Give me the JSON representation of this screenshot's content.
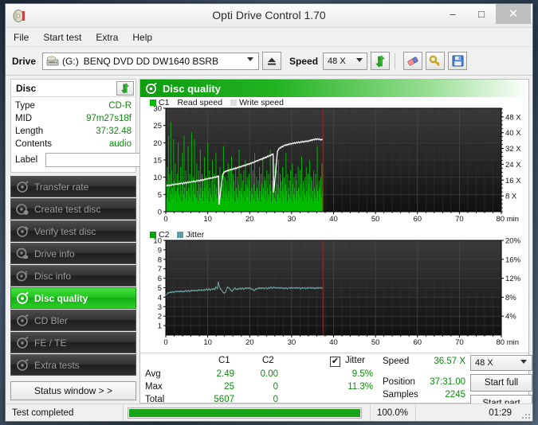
{
  "window": {
    "title": "Opti Drive Control 1.70",
    "app_icon": "disc-icon",
    "minimize": "–",
    "maximize": "□",
    "close": "✕"
  },
  "menubar": {
    "items": [
      {
        "label": "File"
      },
      {
        "label": "Start test"
      },
      {
        "label": "Extra"
      },
      {
        "label": "Help"
      }
    ]
  },
  "toolbar": {
    "drive_label": "Drive",
    "drive_letter": "(G:)",
    "drive_name": "BENQ DVD DD DW1640 BSRB",
    "drive_icon": "optical-drive-icon",
    "eject_icon": "eject-icon",
    "speed_label": "Speed",
    "speed_value": "48 X",
    "refresh_icon": "refresh-icon",
    "eraser_icon": "eraser-icon",
    "key_icon": "key-icon",
    "save_icon": "save-icon"
  },
  "sidebar": {
    "disc_panel": {
      "title": "Disc",
      "refresh_icon": "refresh-icon",
      "rows": [
        {
          "key": "Type",
          "value": "CD-R"
        },
        {
          "key": "MID",
          "value": "97m27s18f"
        },
        {
          "key": "Length",
          "value": "37:32.48"
        },
        {
          "key": "Contents",
          "value": "audio"
        }
      ],
      "label_key": "Label",
      "label_value": "",
      "label_placeholder": "",
      "label_disc_icon": "cd-disc-icon"
    },
    "nav_items": [
      {
        "label": "Transfer rate",
        "icon": "disc-test-icon",
        "active": false
      },
      {
        "label": "Create test disc",
        "icon": "disc-create-icon",
        "active": false
      },
      {
        "label": "Verify test disc",
        "icon": "disc-verify-icon",
        "active": false
      },
      {
        "label": "Drive info",
        "icon": "drive-info-icon",
        "active": false
      },
      {
        "label": "Disc info",
        "icon": "disc-info-icon",
        "active": false
      },
      {
        "label": "Disc quality",
        "icon": "disc-quality-icon",
        "active": true
      },
      {
        "label": "CD Bler",
        "icon": "cd-bler-icon",
        "active": false
      },
      {
        "label": "FE / TE",
        "icon": "fe-te-icon",
        "active": false
      },
      {
        "label": "Extra tests",
        "icon": "extra-tests-icon",
        "active": false
      }
    ],
    "status_window_button": "Status window > >"
  },
  "result": {
    "header_title": "Disc quality",
    "header_icon": "disc-quality-icon"
  },
  "stats": {
    "col_c1": "C1",
    "col_c2": "C2",
    "col_jitter": "Jitter",
    "jitter_checked": true,
    "jitter_check_glyph": "✔",
    "row_avg": "Avg",
    "row_max": "Max",
    "row_total": "Total",
    "c1_avg": "2.49",
    "c1_max": "25",
    "c1_total": "5607",
    "c2_avg": "0.00",
    "c2_max": "0",
    "c2_total": "0",
    "jitter_avg": "9.5%",
    "jitter_max": "11.3%",
    "speed_label": "Speed",
    "speed_value": "36.57 X",
    "position_label": "Position",
    "position_value": "37:31.00",
    "samples_label": "Samples",
    "samples_value": "2245",
    "speed_select_value": "48 X",
    "start_full_button": "Start full",
    "start_part_button": "Start part"
  },
  "statusbar": {
    "message": "Test completed",
    "progress_percent": "100.0%",
    "progress_value": 100,
    "elapsed": "01:29"
  },
  "chart_data": [
    {
      "id": "c1-chart",
      "type": "bar",
      "title": "",
      "xlabel": "min",
      "ylabel": "",
      "xlim": [
        0,
        80
      ],
      "ylim": [
        0,
        30
      ],
      "xticks": [
        0,
        10,
        20,
        30,
        40,
        50,
        60,
        70,
        80
      ],
      "xticklabels": [
        "0",
        "10",
        "20",
        "30",
        "40",
        "50",
        "60",
        "70",
        "80 min"
      ],
      "yticks": [
        0,
        5,
        10,
        15,
        20,
        25,
        30
      ],
      "yticklabels": [
        "0",
        "5",
        "10",
        "15",
        "20",
        "25",
        "30"
      ],
      "y2lim": [
        0,
        52.36
      ],
      "y2ticks": [
        8,
        16,
        24,
        32,
        40,
        48
      ],
      "y2ticklabels": [
        "8 X",
        "16 X",
        "24 X",
        "32 X",
        "40 X",
        "48 X"
      ],
      "grid": true,
      "legend": [
        {
          "label": "C1",
          "color": "#00c000",
          "swatch": true
        },
        {
          "label": "Read speed",
          "color": "#ffffff",
          "swatch": false
        },
        {
          "label": "Write speed",
          "color": "#d8d8d8",
          "swatch": true
        }
      ],
      "marker_line": {
        "x": 37.5,
        "color": "#e00000"
      },
      "data_end_x": 37.55,
      "series": [
        {
          "name": "C1",
          "color": "#00c000",
          "x_start": 0,
          "x_end": 37.55,
          "values": [
            9,
            4,
            13,
            7,
            22,
            3,
            11,
            6,
            26,
            5,
            12,
            7,
            4,
            21,
            9,
            5,
            14,
            6,
            3,
            11,
            7,
            20,
            5,
            9,
            4,
            13,
            6,
            3,
            17,
            8,
            5,
            22,
            7,
            4,
            12,
            9,
            6,
            3,
            19,
            7,
            5,
            11,
            4,
            8,
            23,
            6,
            3,
            10,
            7,
            21,
            5,
            9,
            4,
            14,
            6,
            3,
            12,
            8,
            5,
            18,
            7,
            4,
            11,
            9,
            6,
            3,
            16,
            7,
            5,
            10,
            4,
            8,
            20,
            6,
            3,
            12,
            7,
            5,
            9,
            4,
            15,
            6,
            3,
            11,
            8,
            5,
            17,
            7,
            4,
            10,
            9,
            6,
            3,
            13,
            7,
            5,
            11,
            4,
            8,
            19,
            6,
            3,
            10,
            7,
            5,
            9,
            4,
            14,
            6,
            3,
            12,
            8,
            5,
            16,
            7,
            4,
            11,
            9,
            6,
            3,
            13,
            7,
            5,
            10,
            4,
            8,
            18,
            6,
            3,
            11,
            7,
            5,
            9,
            4,
            12,
            6,
            3,
            15,
            8,
            5,
            10,
            7,
            4,
            11,
            9,
            6,
            3,
            14,
            7,
            5,
            12,
            4,
            8,
            17,
            6,
            3,
            10,
            7,
            5,
            9,
            4,
            13,
            6,
            3,
            11,
            8,
            5,
            16,
            7,
            4,
            10,
            9,
            6,
            3,
            12,
            7,
            5,
            11,
            4,
            8,
            18,
            6,
            3,
            9,
            7,
            5,
            10,
            4,
            14,
            6,
            3,
            12,
            8,
            5,
            15,
            7,
            4,
            11,
            9,
            6,
            3,
            13,
            7,
            5,
            10,
            4,
            8,
            17,
            6,
            3,
            11,
            7,
            5,
            9,
            4,
            12,
            6,
            3,
            14,
            8,
            5,
            10,
            7,
            4,
            11,
            9,
            6,
            3,
            13,
            7,
            5,
            12,
            4,
            8,
            16,
            6,
            3,
            9,
            7,
            5,
            10,
            4,
            13,
            6,
            3,
            11,
            8,
            5,
            15,
            7,
            4,
            10,
            9,
            6,
            3,
            12,
            7,
            5,
            11,
            4,
            8,
            19,
            6,
            3,
            9,
            7,
            5,
            10,
            4,
            14,
            6,
            3
          ]
        },
        {
          "name": "Read speed",
          "color": "#ffffff",
          "unit": "X",
          "points": [
            [
              0.0,
              13.2
            ],
            [
              1.0,
              13.4
            ],
            [
              2.0,
              13.8
            ],
            [
              3.0,
              14.1
            ],
            [
              4.0,
              14.4
            ],
            [
              5.0,
              14.7
            ],
            [
              6.0,
              15.1
            ],
            [
              7.0,
              15.4
            ],
            [
              8.0,
              15.8
            ],
            [
              9.0,
              16.2
            ],
            [
              10.0,
              16.7
            ],
            [
              11.0,
              17.1
            ],
            [
              12.0,
              17.6
            ],
            [
              12.6,
              18.0
            ],
            [
              12.7,
              3.6
            ],
            [
              13.2,
              12.5
            ],
            [
              13.6,
              19.0
            ],
            [
              14.0,
              20.2
            ],
            [
              15.0,
              21.0
            ],
            [
              16.0,
              21.6
            ],
            [
              17.0,
              22.2
            ],
            [
              18.0,
              22.9
            ],
            [
              19.0,
              23.6
            ],
            [
              20.0,
              24.3
            ],
            [
              21.0,
              25.1
            ],
            [
              22.0,
              26.0
            ],
            [
              23.0,
              26.8
            ],
            [
              24.0,
              27.7
            ],
            [
              25.0,
              28.6
            ],
            [
              25.6,
              29.2
            ],
            [
              25.7,
              9.6
            ],
            [
              26.2,
              20.0
            ],
            [
              26.6,
              30.4
            ],
            [
              27.0,
              32.0
            ],
            [
              28.0,
              33.3
            ],
            [
              29.0,
              34.0
            ],
            [
              30.0,
              34.5
            ],
            [
              31.0,
              34.9
            ],
            [
              32.0,
              35.2
            ],
            [
              33.0,
              35.5
            ],
            [
              34.0,
              35.8
            ],
            [
              35.0,
              36.4
            ],
            [
              36.0,
              36.8
            ],
            [
              37.0,
              36.5
            ],
            [
              37.5,
              36.57
            ]
          ]
        }
      ]
    },
    {
      "id": "c2-jitter-chart",
      "type": "line",
      "title": "",
      "xlabel": "min",
      "ylabel": "",
      "xlim": [
        0,
        80
      ],
      "ylim": [
        0,
        10
      ],
      "xticks": [
        0,
        10,
        20,
        30,
        40,
        50,
        60,
        70,
        80
      ],
      "xticklabels": [
        "0",
        "10",
        "20",
        "30",
        "40",
        "50",
        "60",
        "70",
        "80 min"
      ],
      "yticks": [
        1,
        2,
        3,
        4,
        5,
        6,
        7,
        8,
        9,
        10
      ],
      "yticklabels": [
        "1",
        "2",
        "3",
        "4",
        "5",
        "6",
        "7",
        "8",
        "9",
        "10"
      ],
      "y2lim": [
        0,
        20
      ],
      "y2ticks": [
        4,
        8,
        12,
        16,
        20
      ],
      "y2ticklabels": [
        "4%",
        "8%",
        "12%",
        "16%",
        "20%"
      ],
      "grid": true,
      "legend": [
        {
          "label": "C2",
          "color": "#00a000",
          "swatch": true
        },
        {
          "label": "Jitter",
          "color": "#63a6a6",
          "swatch": true
        }
      ],
      "marker_line": {
        "x": 37.5,
        "color": "#e00000"
      },
      "data_end_x": 37.55,
      "series": [
        {
          "name": "C2",
          "color": "#00a000",
          "values": []
        },
        {
          "name": "Jitter",
          "color": "#6fa8a8",
          "unit": "%",
          "x_start": 0,
          "x_end": 37.55,
          "values": [
            8.4,
            8.6,
            8.8,
            8.9,
            9.0,
            9.0,
            9.1,
            9.0,
            9.2,
            9.0,
            9.1,
            9.2,
            9.1,
            9.3,
            9.2,
            9.1,
            9.3,
            9.2,
            9.3,
            9.2,
            9.1,
            9.3,
            9.2,
            9.4,
            9.3,
            9.2,
            9.4,
            9.3,
            9.2,
            9.4,
            9.3,
            9.5,
            9.4,
            9.3,
            9.5,
            9.4,
            9.3,
            9.5,
            9.4,
            9.6,
            9.5,
            9.4,
            9.6,
            9.5,
            9.4,
            9.6,
            9.5,
            9.7,
            9.6,
            9.5,
            9.7,
            9.6,
            9.5,
            9.7,
            9.6,
            9.8,
            9.7,
            9.6,
            10.2,
            10.0,
            9.8,
            11.3,
            10.4,
            9.9,
            9.7,
            9.4,
            9.2,
            9.0,
            8.8,
            9.0,
            9.4,
            9.8,
            10.2,
            10.0,
            9.8,
            9.6,
            9.4,
            9.2,
            9.5,
            9.7,
            9.9,
            9.8,
            9.7,
            9.6,
            9.8,
            9.7,
            9.9,
            9.8,
            9.7,
            9.9,
            9.8,
            9.7,
            9.9,
            9.8,
            10.0,
            9.9,
            9.8,
            10.0,
            9.9,
            9.8,
            9.7,
            9.6,
            9.5,
            9.4,
            9.6,
            9.8,
            9.7,
            9.9,
            9.8,
            10.0,
            9.9,
            9.8,
            10.0,
            9.9,
            9.8,
            9.9,
            10.0,
            9.9,
            9.8,
            9.9,
            10.0,
            9.9,
            10.1,
            10.0,
            9.9,
            10.0,
            10.1,
            10.0,
            9.9,
            10.0,
            9.9,
            10.0,
            9.9,
            10.0,
            9.9,
            10.0,
            9.9,
            9.8,
            9.9,
            10.0,
            9.9,
            9.8,
            9.9,
            10.0,
            9.9,
            10.0,
            9.9,
            10.0,
            9.9,
            10.0,
            9.9,
            10.0,
            9.9,
            10.0,
            9.9,
            10.0,
            9.9,
            9.8,
            9.9,
            10.0,
            9.9,
            10.0,
            9.9,
            9.8,
            9.9,
            10.0,
            9.9,
            10.0,
            9.9,
            10.0,
            9.9,
            10.0,
            9.9,
            9.8,
            9.9,
            10.0,
            9.9,
            10.0,
            9.9,
            10.0,
            9.9,
            10.0,
            9.9,
            10.0
          ]
        }
      ]
    }
  ]
}
